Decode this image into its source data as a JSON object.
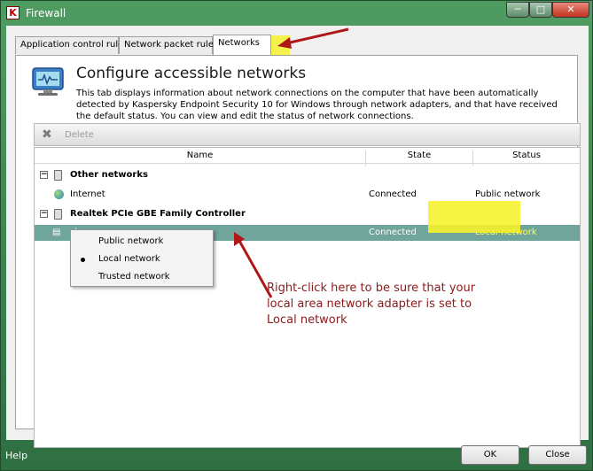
{
  "window": {
    "title": "Firewall",
    "app_icon_glyph": "K",
    "min_glyph": "─",
    "max_glyph": "□",
    "close_glyph": "✕"
  },
  "tabs": [
    {
      "label": "Application control rules"
    },
    {
      "label": "Network packet rules"
    },
    {
      "label": "Networks",
      "active": true
    }
  ],
  "header": {
    "title": "Configure accessible networks",
    "description": "This tab displays information about network connections on the computer that have been automatically detected by Kaspersky Endpoint Security 10 for Windows through network adapters, and that have received the default status. You can view and edit the status of network connections."
  },
  "toolbar": {
    "delete_label": "Delete",
    "delete_icon": "x-icon"
  },
  "columns": {
    "name": "Name",
    "state": "State",
    "status": "Status"
  },
  "groups": [
    {
      "name": "Other networks",
      "expander": "−",
      "rows": [
        {
          "name": "Internet",
          "state": "Connected",
          "status": "Public network"
        }
      ]
    },
    {
      "name": "Realtek PCIe GBE Family Controller",
      "expander": "−",
      "rows": [
        {
          "name": "sbs",
          "state": "Connected",
          "status": "Local network",
          "selected": true
        }
      ]
    }
  ],
  "context_menu": {
    "items": [
      {
        "label": "Public network"
      },
      {
        "label": "Local network",
        "checked": true
      },
      {
        "label": "Trusted network"
      }
    ]
  },
  "annotation": {
    "text": "Right-click here to be sure that your local area network adapter is set to Local network"
  },
  "footer": {
    "help_label": "Help",
    "ok_label": "OK",
    "close_label": "Close"
  },
  "colors": {
    "highlight_yellow": "#f6f22e",
    "arrow_red": "#b01818",
    "selected_row": "#6fa59a",
    "window_green": "#3b7a4f"
  }
}
